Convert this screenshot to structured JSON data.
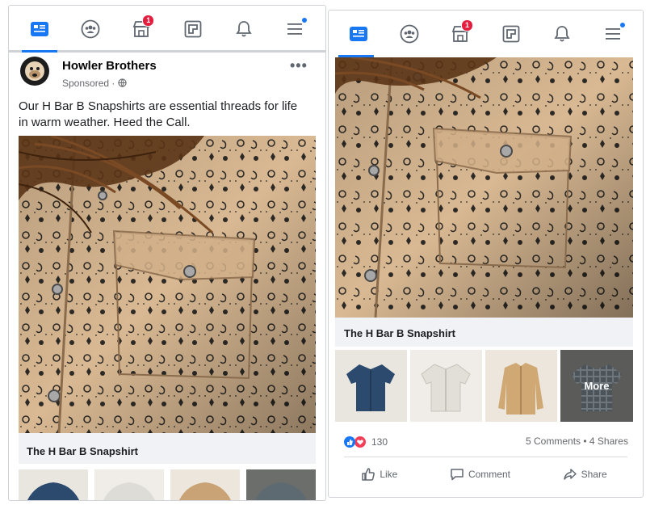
{
  "nav": {
    "tabs": [
      {
        "icon": "news-feed-icon"
      },
      {
        "icon": "groups-icon"
      },
      {
        "icon": "marketplace-icon",
        "badge": "1"
      },
      {
        "icon": "pages-icon"
      },
      {
        "icon": "notifications-icon"
      },
      {
        "icon": "menu-icon",
        "dot": true
      }
    ]
  },
  "post": {
    "page_name": "Howler Brothers",
    "sponsored_label": "Sponsored",
    "caption": "Our H Bar B Snapshirts are essential threads for life in warm weather. Heed the Call.",
    "product_title": "The H Bar B Snapshirt"
  },
  "thumbnails": [
    {
      "name": "blue-shirt"
    },
    {
      "name": "white-shirt"
    },
    {
      "name": "tan-shirt"
    },
    {
      "name": "plaid-shirt",
      "overlay": "More"
    }
  ],
  "engagement": {
    "reaction_count": "130",
    "comments": "5 Comments",
    "separator": "•",
    "shares": "4 Shares"
  },
  "actions": {
    "like": "Like",
    "comment": "Comment",
    "share": "Share"
  },
  "colors": {
    "accent": "#1877f2",
    "badge": "#e41e3f",
    "shirt_tan": "#d8b590"
  }
}
